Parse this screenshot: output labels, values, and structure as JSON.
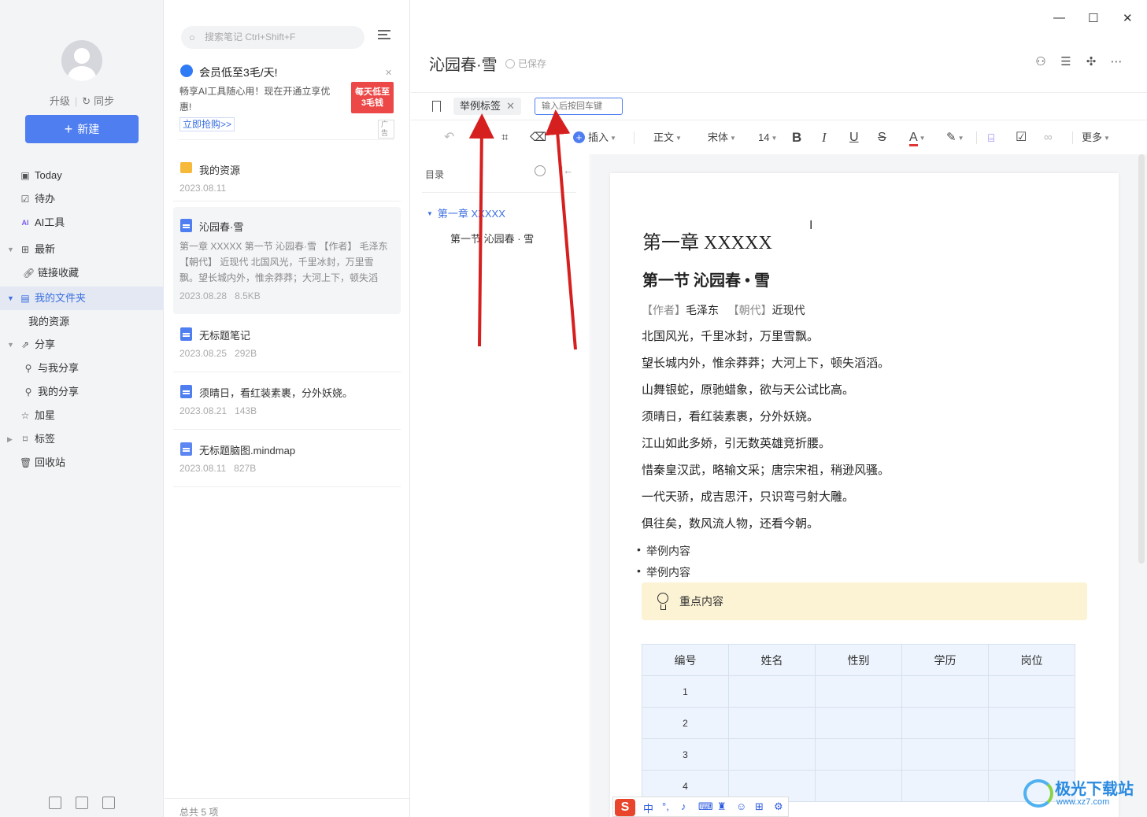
{
  "sidebar": {
    "upgrade": "升级",
    "sync": "同步",
    "new_button": "新建",
    "items": [
      {
        "label": "Today",
        "icon": "calendar-icon"
      },
      {
        "label": "待办",
        "icon": "checkbox-icon"
      },
      {
        "label": "AI工具",
        "icon": "ai-icon"
      },
      {
        "label": "最新",
        "icon": "grid-icon"
      },
      {
        "label": "链接收藏",
        "icon": "link-icon"
      },
      {
        "label": "我的文件夹",
        "icon": "folder-icon"
      },
      {
        "label": "我的资源",
        "icon": ""
      },
      {
        "label": "分享",
        "icon": "share-icon"
      },
      {
        "label": "与我分享",
        "icon": "user-icon"
      },
      {
        "label": "我的分享",
        "icon": "user-icon"
      },
      {
        "label": "加星",
        "icon": "star-icon"
      },
      {
        "label": "标签",
        "icon": "bookmark-icon"
      },
      {
        "label": "回收站",
        "icon": "trash-icon"
      }
    ]
  },
  "notelist": {
    "search_placeholder": "搜索笔记 Ctrl+Shift+F",
    "promo": {
      "title": "会员低至3毛/天!",
      "desc": "畅享AI工具随心用！现在开通立享优惠!",
      "cta": "立即抢购>>",
      "badge_line1": "每天低至",
      "badge_line2": "3毛钱",
      "ad": "广告"
    },
    "notes": [
      {
        "title": "我的资源",
        "date": "2023.08.11",
        "size": ""
      },
      {
        "title": "沁园春·雪",
        "excerpt": "第一章 XXXXX 第一节 沁园春·雪 【作者】 毛泽东 【朝代】 近现代 北国风光，千里冰封，万里雪飘。望长城内外，惟余莽莽；大河上下，顿失滔滔。 ...",
        "date": "2023.08.28",
        "size": "8.5KB"
      },
      {
        "title": "无标题笔记",
        "date": "2023.08.25",
        "size": "292B"
      },
      {
        "title": "须晴日，看红装素裹，分外妖娆。",
        "date": "2023.08.21",
        "size": "143B"
      },
      {
        "title": "无标题脑图.mindmap",
        "date": "2023.08.11",
        "size": "827B"
      }
    ],
    "footer": "总共 5 项"
  },
  "editor": {
    "title": "沁园春·雪",
    "saved": "已保存",
    "tag": "举例标签",
    "tag_input_placeholder": "输入后按回车键",
    "toolbar": {
      "insert": "插入",
      "style": "正文",
      "font": "宋体",
      "size": "14",
      "bold": "B",
      "italic": "I",
      "underline": "U",
      "strike": "S",
      "color_a": "A",
      "more": "更多"
    },
    "toc": {
      "head": "目录",
      "item1": "第一章 XXXXX",
      "item2": "第一节 沁园春 · 雪"
    },
    "doc": {
      "h1": "第一章  XXXXX",
      "h2": "第一节  沁园春 • 雪",
      "author_label": "【作者】",
      "author": "毛泽东",
      "dynasty_label": "【朝代】",
      "dynasty": "近现代",
      "lines": [
        "北国风光，千里冰封，万里雪飘。",
        "望长城内外，惟余莽莽；大河上下，顿失滔滔。",
        "山舞银蛇，原驰蜡象，欲与天公试比高。",
        "须晴日，看红装素裹，分外妖娆。",
        "江山如此多娇，引无数英雄竞折腰。",
        "惜秦皇汉武，略输文采；唐宗宋祖，稍逊风骚。",
        "一代天骄，成吉思汗，只识弯弓射大雕。",
        "俱往矣，数风流人物，还看今朝。"
      ],
      "bullets": [
        "举例内容",
        "举例内容"
      ],
      "callout": "重点内容",
      "table_headers": [
        "编号",
        "姓名",
        "性别",
        "学历",
        "岗位"
      ],
      "table_rows": [
        "1",
        "2",
        "3",
        "4"
      ]
    }
  },
  "ime": {
    "lang": "中"
  },
  "watermark": {
    "line1": "极光下载站",
    "line2": "www.xz7.com"
  },
  "colors": {
    "accent": "#4f7ef0",
    "annotation_arrow": "#d61f1f",
    "callout_bg": "#fcf2d4"
  }
}
